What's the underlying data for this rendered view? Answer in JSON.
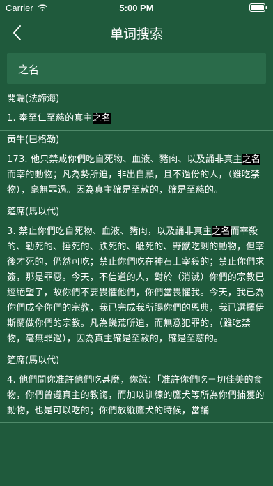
{
  "status_bar": {
    "carrier": "Carrier",
    "time": "5:00 PM"
  },
  "nav": {
    "title": "单词搜索",
    "back_icon": "chevron-left-icon"
  },
  "search": {
    "value": "之名"
  },
  "colors": {
    "background": "#1f5a3c",
    "search_box": "#2a6b4a",
    "highlight_bg": "#000000",
    "divider": "#4f8a6a"
  },
  "results": [
    {
      "title": "開端(法諦海)",
      "before": "1. 奉至仁至慈的真主",
      "highlight": "之名",
      "after": ""
    },
    {
      "title": "黄牛(巴格勒)",
      "before": "173. 他只禁戒你們吃自死物、血液、豬肉、以及誦非真主",
      "highlight": "之名",
      "after": "而宰的動物；凡為勢所迫，非出自願，且不過份的人，（雖吃禁物），毫無罪過。因為真主確是至赦的，確是至慈的。"
    },
    {
      "title": "筵席(馬以代)",
      "before": "3. 禁止你們吃自死物、血液、豬肉，以及誦非真主",
      "highlight": "之名",
      "after": "而宰殺的、勒死的、捶死的、跌死的、觝死的、野獸吃剩的動物，但宰後才死的，仍然可吃；禁止你們吃在神石上宰殺的；禁止你們求簽，那是罪惡。今天，不信道的人，對於（消滅）你們的宗教已經絕望了，故你們不要畏懼他們，你們當畏懼我。今天，我已為你們成全你們的宗教，我已完成我所賜你們的恩典，我已選擇伊斯蘭做你們的宗教。凡為饑荒所迫，而無意犯罪的，（雖吃禁物，毫無罪過），因為真主確是至赦的，確是至慈的。"
    },
    {
      "title": "筵席(馬以代)",
      "before": "4. 他們問你准許他們吃甚麼，你說：「准許你們吃－切佳美的食物，你們曾遵真主的教誨，而加以訓練的鷹犬等所為你們捕獲的動物，也是可以吃的；你們放縱鷹犬的時候，當誦",
      "highlight": "",
      "after": ""
    }
  ]
}
